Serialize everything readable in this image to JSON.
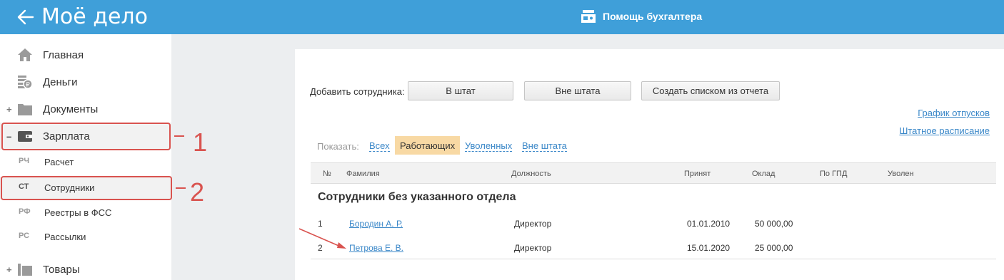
{
  "header": {
    "logo_text": "Моё дело",
    "helper_label": "Помощь бухгалтера",
    "bg_color": "#3f9fd9"
  },
  "sidebar": {
    "items": [
      {
        "label": "Главная",
        "icon": "home-icon"
      },
      {
        "label": "Деньги",
        "icon": "money-icon"
      },
      {
        "label": "Документы",
        "icon": "folder-icon",
        "toggle": "+"
      },
      {
        "label": "Зарплата",
        "icon": "wallet-icon",
        "toggle": "–"
      },
      {
        "label": "Товары",
        "icon": "box-icon",
        "toggle": "+"
      }
    ],
    "subitems": [
      {
        "abbr": "РЧ",
        "label": "Расчет"
      },
      {
        "abbr": "СТ",
        "label": "Сотрудники"
      },
      {
        "abbr": "РФ",
        "label": "Реестры в ФСС"
      },
      {
        "abbr": "РС",
        "label": "Рассылки"
      }
    ]
  },
  "annotations": {
    "label_1": "1",
    "label_2": "2",
    "color": "#d9534f"
  },
  "main": {
    "add_label": "Добавить сотрудника:",
    "buttons": {
      "in_staff": "В штат",
      "out_staff": "Вне штата",
      "from_report": "Создать списком из отчета"
    },
    "links": {
      "vacation": "График отпусков",
      "staffing": "Штатное расписание"
    },
    "filter": {
      "show_label": "Показать:",
      "all": "Всех",
      "working": "Работающих",
      "fired": "Уволенных",
      "out_staff": "Вне штата"
    },
    "table": {
      "columns": [
        "№",
        "Фамилия",
        "Должность",
        "Принят",
        "Оклад",
        "По ГПД",
        "Уволен"
      ],
      "section_title": "Сотрудники без указанного отдела",
      "rows": [
        {
          "num": "1",
          "name": "Бородин А. Р.",
          "position": "Директор",
          "hired": "01.01.2010",
          "salary": "50 000,00"
        },
        {
          "num": "2",
          "name": "Петрова Е. В.",
          "position": "Директор",
          "hired": "15.01.2020",
          "salary": "25 000,00"
        }
      ]
    }
  }
}
